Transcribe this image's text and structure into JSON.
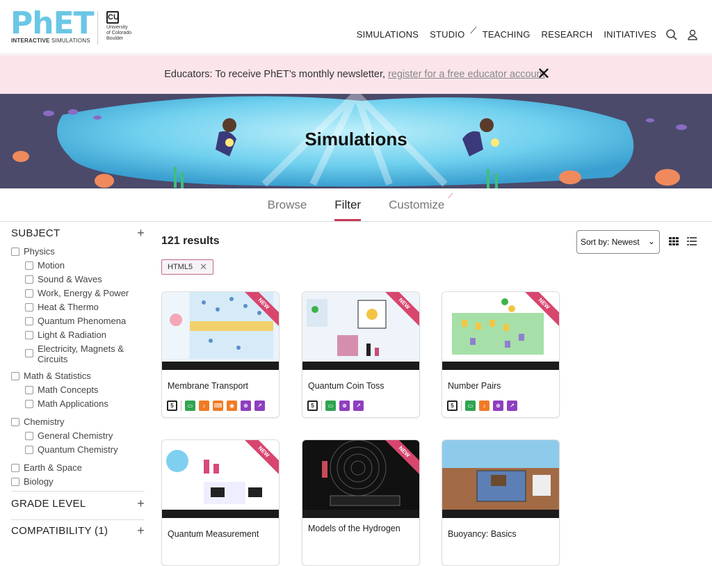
{
  "header": {
    "logo_main": [
      "Ph",
      "ET"
    ],
    "logo_sub_bold": "INTERACTIVE",
    "logo_sub_light": "SIMULATIONS",
    "cu_lines": [
      "University",
      "of Colorado",
      "Boulder"
    ],
    "nav": [
      "SIMULATIONS",
      "STUDIO",
      "TEACHING",
      "RESEARCH",
      "INITIATIVES"
    ]
  },
  "newsletter": {
    "text": "Educators: To receive PhET’s monthly newsletter,",
    "link": "register for a free educator account",
    "end": "."
  },
  "hero": {
    "title": "Simulations"
  },
  "tabs": [
    "Browse",
    "Filter",
    "Customize"
  ],
  "sidebar": {
    "subject_title": "SUBJECT",
    "groups": [
      {
        "label": "Physics",
        "items": [
          "Motion",
          "Sound & Waves",
          "Work, Energy & Power",
          "Heat & Thermo",
          "Quantum Phenomena",
          "Light & Radiation",
          "Electricity, Magnets & Circuits"
        ]
      },
      {
        "label": "Math & Statistics",
        "items": [
          "Math Concepts",
          "Math Applications"
        ]
      },
      {
        "label": "Chemistry",
        "items": [
          "General Chemistry",
          "Quantum Chemistry"
        ]
      },
      {
        "label": "Earth & Space",
        "items": []
      },
      {
        "label": "Biology",
        "items": []
      }
    ],
    "grade_title": "GRADE LEVEL",
    "compat_title": "COMPATIBILITY (1)"
  },
  "main": {
    "results": "121 results",
    "sort_label": "Sort by:",
    "sort_value": "Newest",
    "chip": "HTML5",
    "ribbon": "NEW",
    "cards": [
      {
        "title": "Membrane Transport",
        "new": true,
        "icons": [
          "html5",
          "sep",
          "green",
          "orange",
          "orange",
          "orange",
          "purple",
          "purple"
        ]
      },
      {
        "title": "Quantum Coin Toss",
        "new": true,
        "icons": [
          "html5",
          "sep",
          "green",
          "purple",
          "purple"
        ]
      },
      {
        "title": "Number Pairs",
        "new": true,
        "icons": [
          "html5",
          "sep",
          "green",
          "orange",
          "purple",
          "purple"
        ]
      },
      {
        "title": "Quantum Measurement",
        "new": true,
        "icons": []
      },
      {
        "title": "Models of the Hydrogen",
        "new": true,
        "icons": []
      },
      {
        "title": "Buoyancy: Basics",
        "new": false,
        "icons": []
      }
    ]
  },
  "colors": {
    "accent": "#c83a5c",
    "banner_bg": "#fbe4ea",
    "green": "#2ea44f",
    "orange": "#f07b25",
    "purple": "#8e3fbf"
  }
}
